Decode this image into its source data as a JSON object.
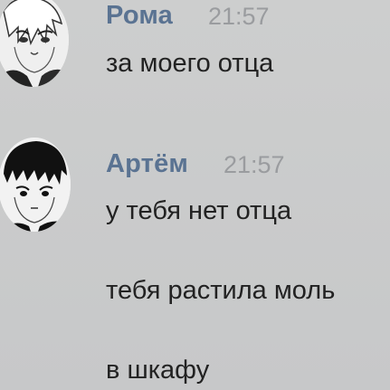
{
  "colors": {
    "background": "#c9cacb",
    "author_name": "#5a7392",
    "timestamp": "#9a9c9f",
    "message_text": "#222222"
  },
  "messages": [
    {
      "author": "Рома",
      "time": "21:57",
      "avatar_icon": "manga-portrait-light-hair-avatar",
      "lines": [
        "за моего отца"
      ]
    },
    {
      "author": "Артём",
      "time": "21:57",
      "avatar_icon": "manga-portrait-dark-hair-avatar",
      "lines": [
        "у тебя нет отца",
        "тебя растила моль",
        "в шкафу"
      ]
    }
  ]
}
